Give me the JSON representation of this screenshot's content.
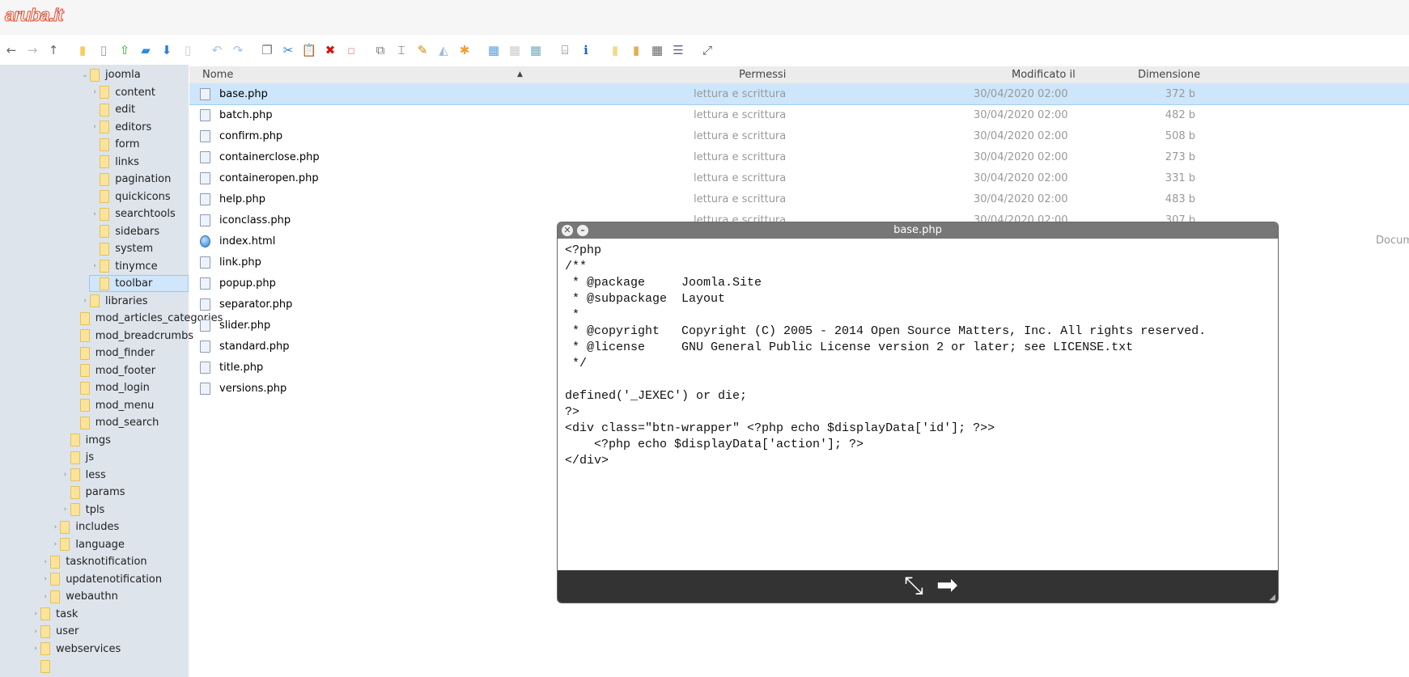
{
  "logo": "aruba.it",
  "toolbar": [
    {
      "name": "back-icon",
      "g": "←",
      "c": "#666"
    },
    {
      "name": "forward-icon",
      "g": "→",
      "c": "#bbb"
    },
    {
      "name": "up-icon",
      "g": "↑",
      "c": "#666"
    },
    {
      "gap": true
    },
    {
      "name": "folder-icon",
      "g": "▮",
      "c": "#f6cc5a"
    },
    {
      "name": "file-icon",
      "g": "▯",
      "c": "#999"
    },
    {
      "name": "upload-icon",
      "g": "⇧",
      "c": "#3a3"
    },
    {
      "name": "open-folder-icon",
      "g": "▰",
      "c": "#2a8ee0"
    },
    {
      "name": "download-icon",
      "g": "⬇",
      "c": "#2a7fd8"
    },
    {
      "name": "file-disabled-icon",
      "g": "▯",
      "c": "#ccc"
    },
    {
      "gap": true
    },
    {
      "name": "undo-icon",
      "g": "↶",
      "c": "#9cc3e8"
    },
    {
      "name": "redo-icon",
      "g": "↷",
      "c": "#9cc3e8"
    },
    {
      "gap": true
    },
    {
      "name": "copy-icon",
      "g": "❐",
      "c": "#777"
    },
    {
      "name": "cut-icon",
      "g": "✂",
      "c": "#2a7fd8"
    },
    {
      "name": "paste-icon",
      "g": "📋",
      "c": "#aa9"
    },
    {
      "name": "delete-icon",
      "g": "✖",
      "c": "#d11"
    },
    {
      "name": "empty-icon",
      "g": "▫",
      "c": "#e99"
    },
    {
      "gap": true
    },
    {
      "name": "duplicate-icon",
      "g": "⧉",
      "c": "#777"
    },
    {
      "name": "rename-icon",
      "g": "⌶",
      "c": "#555"
    },
    {
      "name": "edit-icon",
      "g": "✎",
      "c": "#c80"
    },
    {
      "name": "resize-icon",
      "g": "◭",
      "c": "#9bd"
    },
    {
      "name": "extract-icon",
      "g": "✱",
      "c": "#f0a030"
    },
    {
      "gap": true
    },
    {
      "name": "view-icons-icon",
      "g": "▦",
      "c": "#5aa0e0"
    },
    {
      "name": "view-list-icon",
      "g": "▦",
      "c": "#ccc"
    },
    {
      "name": "view-mixed-icon",
      "g": "▦",
      "c": "#7ab"
    },
    {
      "gap": true
    },
    {
      "name": "preview-icon",
      "g": "⌸",
      "c": "#666"
    },
    {
      "name": "info-icon",
      "g": "ℹ",
      "c": "#1a63c0"
    },
    {
      "gap": true
    },
    {
      "name": "archive-icon",
      "g": "▮",
      "c": "#f3d98a"
    },
    {
      "name": "extract-archive-icon",
      "g": "▮",
      "c": "#e0b050"
    },
    {
      "name": "select-all-icon",
      "g": "▦",
      "c": "#666"
    },
    {
      "name": "columns-icon",
      "g": "☰",
      "c": "#668"
    },
    {
      "gap": true
    },
    {
      "name": "fullscreen-icon",
      "g": "⤢",
      "c": "#555"
    }
  ],
  "tree": [
    {
      "label": "joomla",
      "depth": 5,
      "arrow": "⌄"
    },
    {
      "label": "content",
      "depth": 6,
      "arrow": "›"
    },
    {
      "label": "edit",
      "depth": 6,
      "arrow": ""
    },
    {
      "label": "editors",
      "depth": 6,
      "arrow": "›"
    },
    {
      "label": "form",
      "depth": 6,
      "arrow": ""
    },
    {
      "label": "links",
      "depth": 6,
      "arrow": ""
    },
    {
      "label": "pagination",
      "depth": 6,
      "arrow": ""
    },
    {
      "label": "quickicons",
      "depth": 6,
      "arrow": ""
    },
    {
      "label": "searchtools",
      "depth": 6,
      "arrow": "›"
    },
    {
      "label": "sidebars",
      "depth": 6,
      "arrow": ""
    },
    {
      "label": "system",
      "depth": 6,
      "arrow": ""
    },
    {
      "label": "tinymce",
      "depth": 6,
      "arrow": "›"
    },
    {
      "label": "toolbar",
      "depth": 6,
      "arrow": "",
      "selected": true
    },
    {
      "label": "libraries",
      "depth": 5,
      "arrow": "›"
    },
    {
      "label": "mod_articles_categories",
      "depth": 4,
      "arrow": ""
    },
    {
      "label": "mod_breadcrumbs",
      "depth": 4,
      "arrow": ""
    },
    {
      "label": "mod_finder",
      "depth": 4,
      "arrow": ""
    },
    {
      "label": "mod_footer",
      "depth": 4,
      "arrow": ""
    },
    {
      "label": "mod_login",
      "depth": 4,
      "arrow": ""
    },
    {
      "label": "mod_menu",
      "depth": 4,
      "arrow": ""
    },
    {
      "label": "mod_search",
      "depth": 4,
      "arrow": ""
    },
    {
      "label": "imgs",
      "depth": 3,
      "arrow": ""
    },
    {
      "label": "js",
      "depth": 3,
      "arrow": ""
    },
    {
      "label": "less",
      "depth": 3,
      "arrow": "›"
    },
    {
      "label": "params",
      "depth": 3,
      "arrow": ""
    },
    {
      "label": "tpls",
      "depth": 3,
      "arrow": "›"
    },
    {
      "label": "includes",
      "depth": 2,
      "arrow": "›"
    },
    {
      "label": "language",
      "depth": 2,
      "arrow": "›"
    },
    {
      "label": "tasknotification",
      "depth": 1,
      "arrow": "›"
    },
    {
      "label": "updatenotification",
      "depth": 1,
      "arrow": "›"
    },
    {
      "label": "webauthn",
      "depth": 1,
      "arrow": "›"
    },
    {
      "label": "task",
      "depth": 0,
      "arrow": "›"
    },
    {
      "label": "user",
      "depth": 0,
      "arrow": "›"
    },
    {
      "label": "webservices",
      "depth": 0,
      "arrow": "›"
    },
    {
      "label": "",
      "depth": 0,
      "arrow": ""
    }
  ],
  "columns": {
    "name": "Nome",
    "perm": "Permessi",
    "modified": "Modificato il",
    "size": "Dimensione"
  },
  "files": [
    {
      "name": "base.php",
      "perm": "lettura e scrittura",
      "date": "30/04/2020 02:00",
      "size": "372 b",
      "type": "php",
      "selected": true
    },
    {
      "name": "batch.php",
      "perm": "lettura e scrittura",
      "date": "30/04/2020 02:00",
      "size": "482 b",
      "type": "php"
    },
    {
      "name": "confirm.php",
      "perm": "lettura e scrittura",
      "date": "30/04/2020 02:00",
      "size": "508 b",
      "type": "php"
    },
    {
      "name": "containerclose.php",
      "perm": "lettura e scrittura",
      "date": "30/04/2020 02:00",
      "size": "273 b",
      "type": "php"
    },
    {
      "name": "containeropen.php",
      "perm": "lettura e scrittura",
      "date": "30/04/2020 02:00",
      "size": "331 b",
      "type": "php"
    },
    {
      "name": "help.php",
      "perm": "lettura e scrittura",
      "date": "30/04/2020 02:00",
      "size": "483 b",
      "type": "php"
    },
    {
      "name": "iconclass.php",
      "perm": "lettura e scrittura",
      "date": "30/04/2020 02:00",
      "size": "307 b",
      "type": "php"
    },
    {
      "name": "index.html",
      "type": "html"
    },
    {
      "name": "link.php",
      "type": "php"
    },
    {
      "name": "popup.php",
      "type": "php"
    },
    {
      "name": "separator.php",
      "type": "php"
    },
    {
      "name": "slider.php",
      "type": "php"
    },
    {
      "name": "standard.php",
      "type": "php"
    },
    {
      "name": "title.php",
      "type": "php"
    },
    {
      "name": "versions.php",
      "type": "php"
    }
  ],
  "partial_kind": "Docum",
  "dialog": {
    "title": "base.php",
    "code": "<?php\n/**\n * @package     Joomla.Site\n * @subpackage  Layout\n *\n * @copyright   Copyright (C) 2005 - 2014 Open Source Matters, Inc. All rights reserved.\n * @license     GNU General Public License version 2 or later; see LICENSE.txt\n */\n\ndefined('_JEXEC') or die;\n?>\n<div class=\"btn-wrapper\" <?php echo $displayData['id']; ?>>\n    <?php echo $displayData['action']; ?>\n</div>"
  }
}
